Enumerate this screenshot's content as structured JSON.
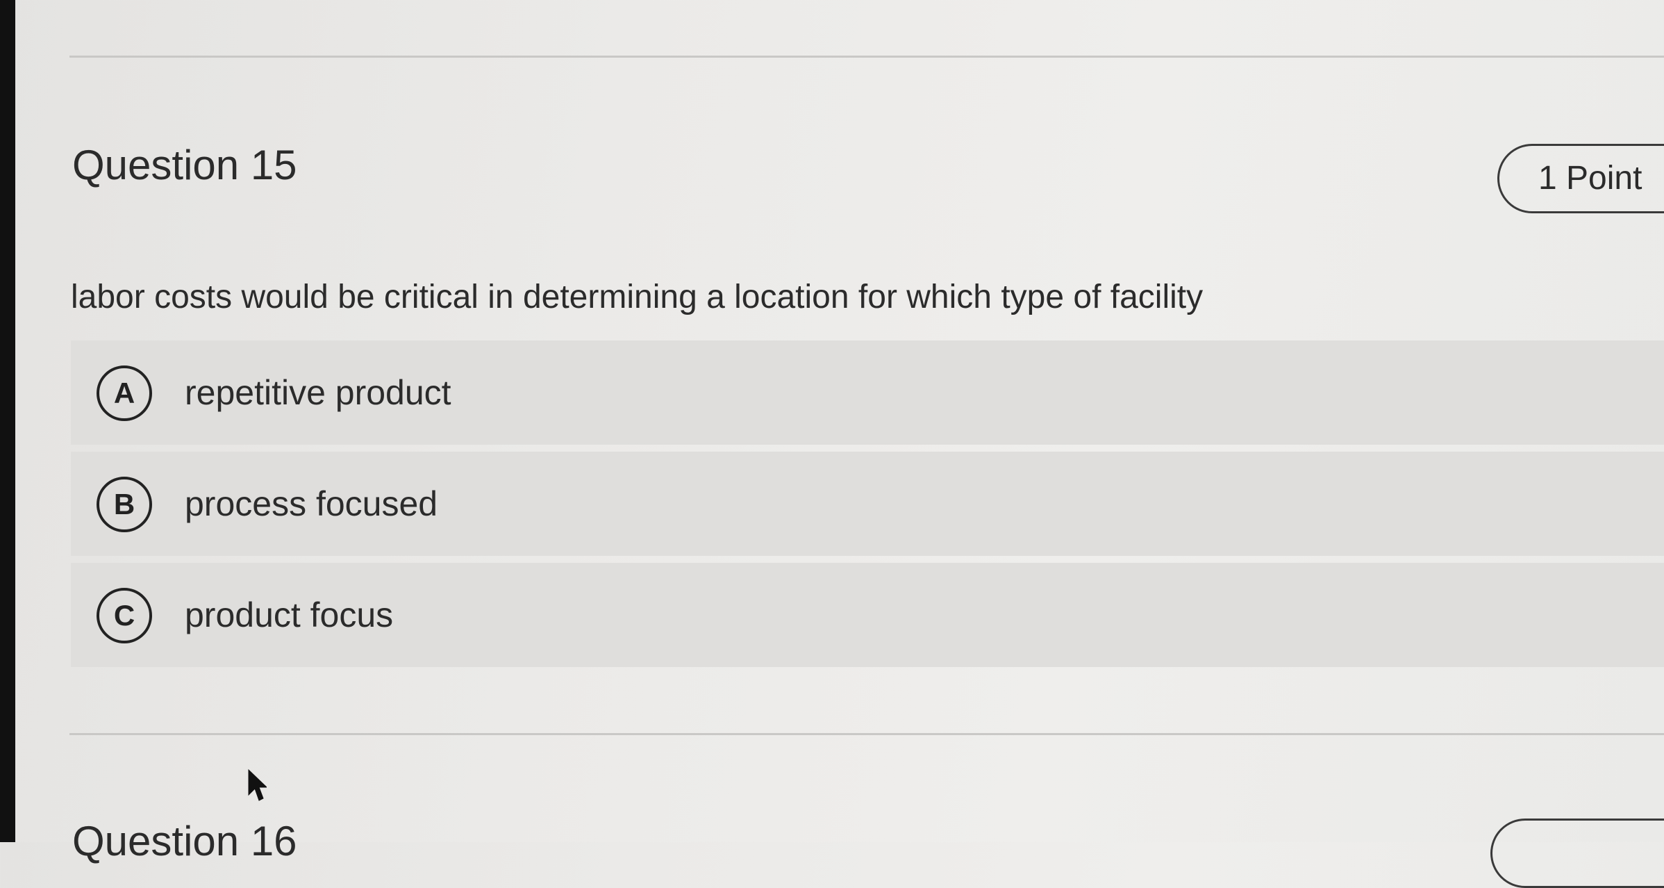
{
  "question": {
    "title": "Question 15",
    "points": "1 Point",
    "prompt": "labor costs would be critical in determining a location for which type of facility",
    "options": [
      {
        "letter": "A",
        "text": "repetitive product"
      },
      {
        "letter": "B",
        "text": "process focused"
      },
      {
        "letter": "C",
        "text": "product focus"
      }
    ]
  },
  "next_question": {
    "title": "Question 16"
  },
  "icons": {
    "cursor": "mouse-pointer-icon"
  }
}
